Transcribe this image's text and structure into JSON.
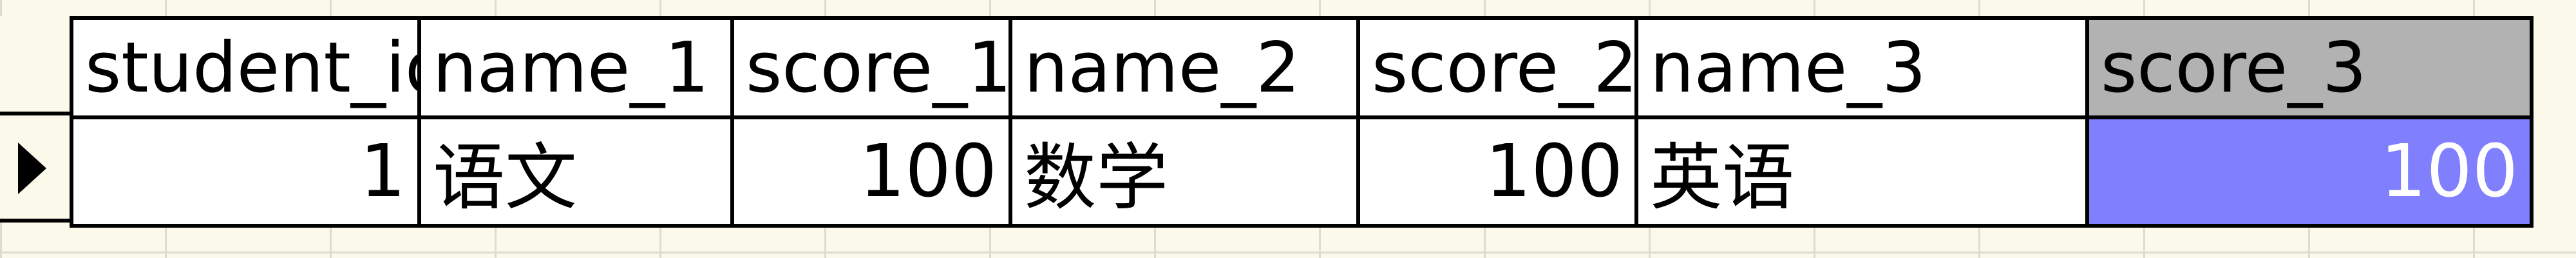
{
  "grid": {
    "columns": [
      {
        "key": "student_id",
        "label": "student_id"
      },
      {
        "key": "name_1",
        "label": "name_1"
      },
      {
        "key": "score_1",
        "label": "score_1"
      },
      {
        "key": "name_2",
        "label": "name_2"
      },
      {
        "key": "score_2",
        "label": "score_2"
      },
      {
        "key": "name_3",
        "label": "name_3"
      },
      {
        "key": "score_3",
        "label": "score_3"
      }
    ],
    "rows": [
      {
        "student_id": "1",
        "name_1": "语文",
        "score_1": "100",
        "name_2": "数学",
        "score_2": "100",
        "name_3": "英语",
        "score_3": "100"
      }
    ],
    "colors": {
      "background": "#fbf9ea",
      "header_active": "#b2b2b2",
      "selected_cell": "#8080ff"
    }
  }
}
